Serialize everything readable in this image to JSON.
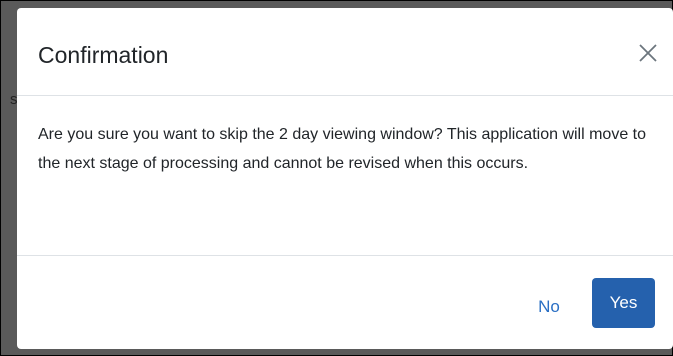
{
  "backdrop": {
    "partial_char": "s"
  },
  "dialog": {
    "title": "Confirmation",
    "message": "Are you sure you want to skip the 2 day viewing window? This application will move to the next stage of processing and cannot be revised when this occurs.",
    "close_icon": "close-icon",
    "buttons": {
      "no_label": "No",
      "yes_label": "Yes"
    }
  },
  "colors": {
    "primary": "#2561ad",
    "link": "#2a6fc4",
    "text": "#212529",
    "divider": "#dee2e6",
    "overlay": "#5a5a5a"
  }
}
